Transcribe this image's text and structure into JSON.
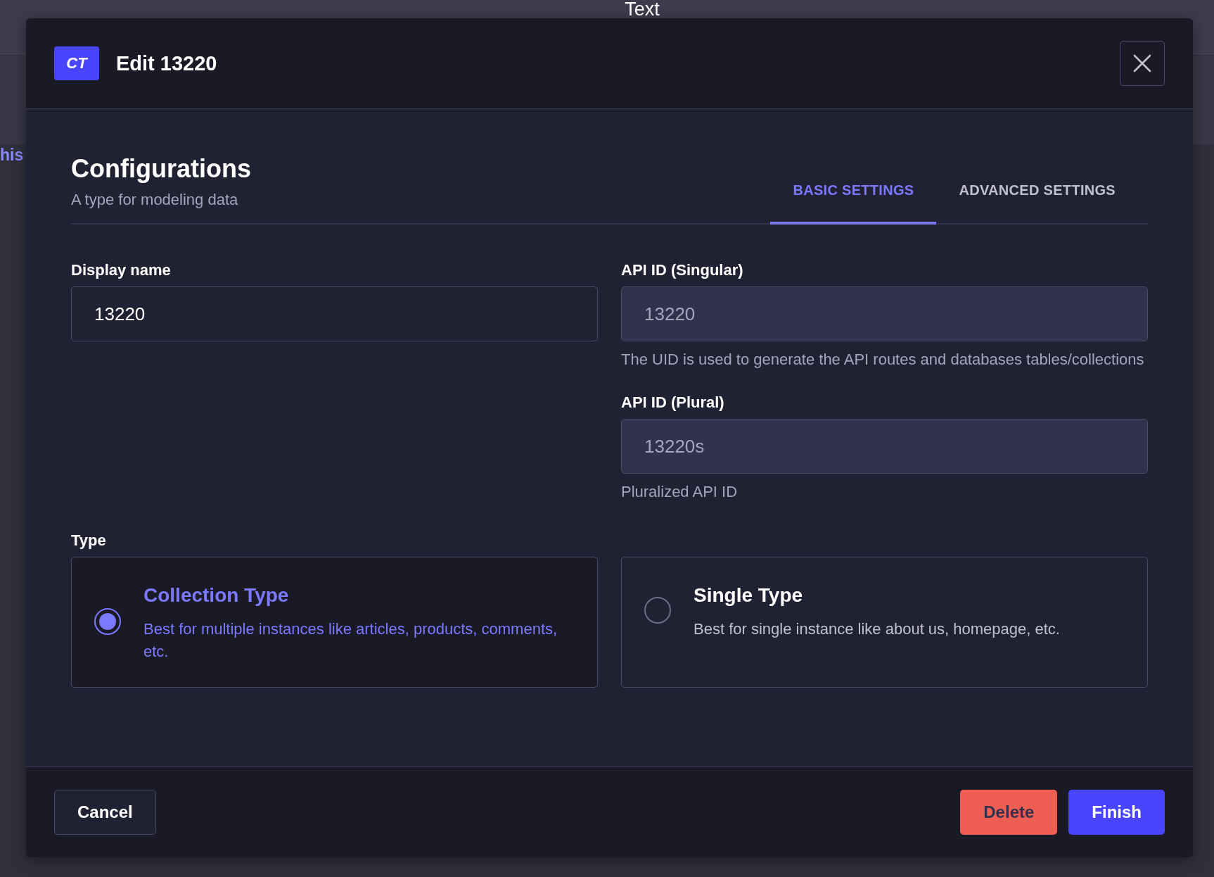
{
  "background": {
    "title": "Text",
    "link_fragment": "his"
  },
  "modal": {
    "badge": "CT",
    "title": "Edit 13220",
    "heading": "Configurations",
    "subtitle": "A type for modeling data",
    "tabs": [
      {
        "label": "BASIC SETTINGS",
        "selected": true
      },
      {
        "label": "ADVANCED SETTINGS",
        "selected": false
      }
    ],
    "left_fields": [
      {
        "label": "Display name",
        "value": "13220",
        "disabled": false
      }
    ],
    "right_fields": [
      {
        "label": "API ID (Singular)",
        "value": "13220",
        "disabled": true,
        "hint": "The UID is used to generate the API routes and databases tables/collections"
      },
      {
        "label": "API ID (Plural)",
        "value": "13220s",
        "disabled": true,
        "hint": "Pluralized API ID"
      }
    ],
    "type": {
      "label": "Type",
      "options": [
        {
          "title": "Collection Type",
          "description": "Best for multiple instances like articles, products, comments, etc.",
          "selected": true
        },
        {
          "title": "Single Type",
          "description": "Best for single instance like about us, homepage, etc.",
          "selected": false
        }
      ]
    },
    "buttons": {
      "cancel": "Cancel",
      "delete": "Delete",
      "finish": "Finish"
    }
  }
}
